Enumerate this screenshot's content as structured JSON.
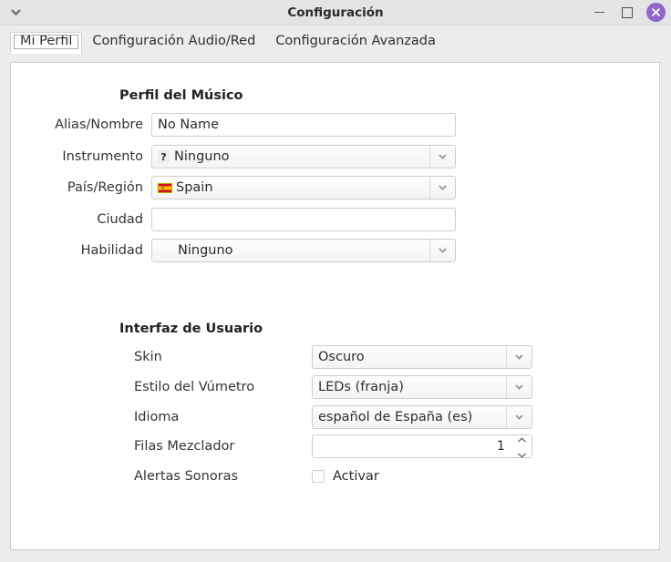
{
  "window": {
    "title": "Configuración",
    "menu_icon": "chevron-down-icon",
    "minimize_label": "—",
    "maximize_label": "□",
    "close_label": "✕"
  },
  "tabs": [
    {
      "label": "Mi Perfil",
      "active": true
    },
    {
      "label": "Configuración Audio/Red",
      "active": false
    },
    {
      "label": "Configuración Avanzada",
      "active": false
    }
  ],
  "profile": {
    "section_title": "Perfil del Músico",
    "fields": {
      "alias": {
        "label": "Alias/Nombre",
        "value": "No Name"
      },
      "instrument": {
        "label": "Instrumento",
        "value": "Ninguno",
        "icon": "question-mark-icon"
      },
      "country": {
        "label": "País/Región",
        "value": "Spain",
        "icon": "spain-flag-icon"
      },
      "city": {
        "label": "Ciudad",
        "value": "",
        "placeholder": ""
      },
      "skill": {
        "label": "Habilidad",
        "value": "Ninguno"
      }
    }
  },
  "ui_section": {
    "section_title": "Interfaz de Usuario",
    "fields": {
      "skin": {
        "label": "Skin",
        "value": "Oscuro"
      },
      "meter_style": {
        "label": "Estilo del Vúmetro",
        "value": "LEDs (franja)"
      },
      "language": {
        "label": "Idioma",
        "value": "español de España (es)"
      },
      "mixer_rows": {
        "label": "Filas Mezclador",
        "value": "1"
      },
      "sound_alerts": {
        "label": "Alertas Sonoras",
        "checkbox_label": "Activar",
        "checked": false
      }
    }
  },
  "colors": {
    "titlebar_bg": "#e4e4e4",
    "window_bg": "#ececec",
    "panel_bg": "#ffffff",
    "close_button": "#8e68cd",
    "border": "#cfcfcf",
    "text": "#2c2c2c"
  }
}
